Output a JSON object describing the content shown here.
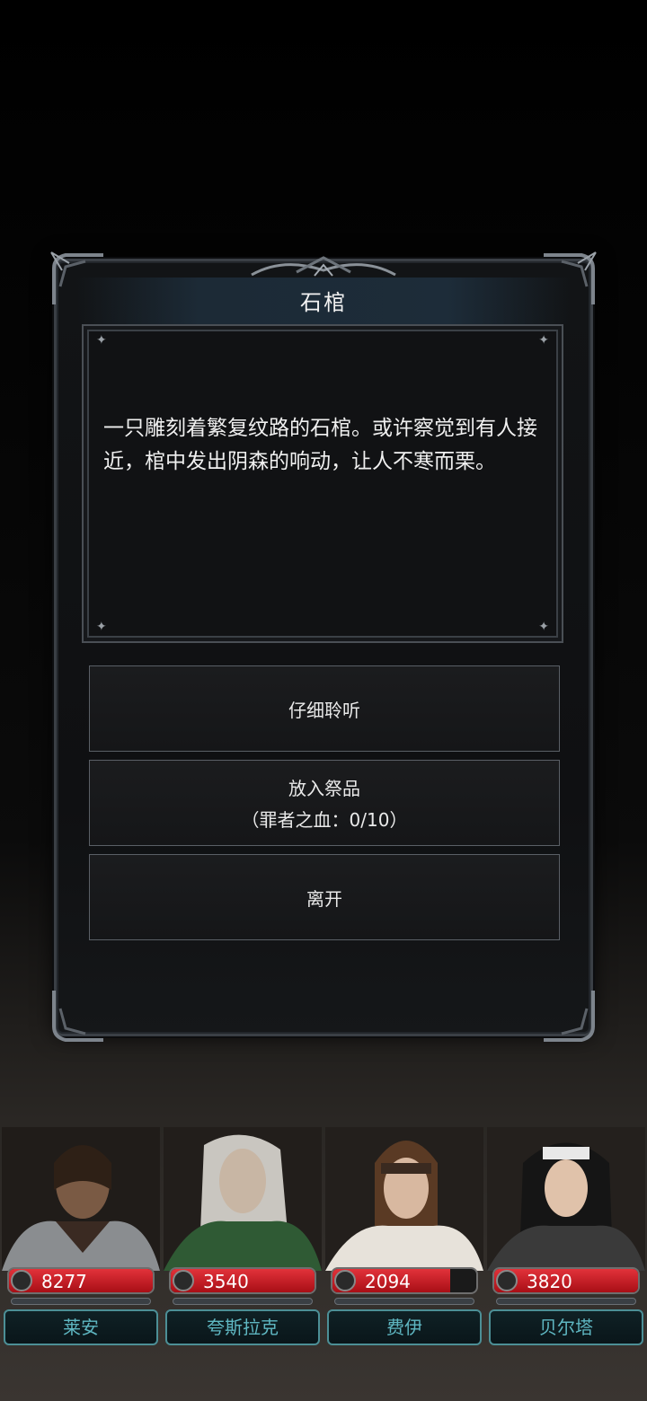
{
  "dialog": {
    "title": "石棺",
    "description": "一只雕刻着繁复纹路的石棺。或许察觉到有人接近，棺中发出阴森的响动，让人不寒而栗。",
    "choices": [
      {
        "label": "仔细聆听",
        "sub": ""
      },
      {
        "label": "放入祭品",
        "sub": "（罪者之血：0/10）"
      },
      {
        "label": "离开",
        "sub": ""
      }
    ]
  },
  "party": [
    {
      "name": "莱安",
      "hp": "8277",
      "hp_fill": 1.0
    },
    {
      "name": "夸斯拉克",
      "hp": "3540",
      "hp_fill": 1.0
    },
    {
      "name": "费伊",
      "hp": "2094",
      "hp_fill": 0.82
    },
    {
      "name": "贝尔塔",
      "hp": "3820",
      "hp_fill": 1.0
    }
  ],
  "colors": {
    "hp_red": "#d0232b",
    "nameplate_text": "#5fb7c2",
    "frame": "#3a3f45"
  }
}
